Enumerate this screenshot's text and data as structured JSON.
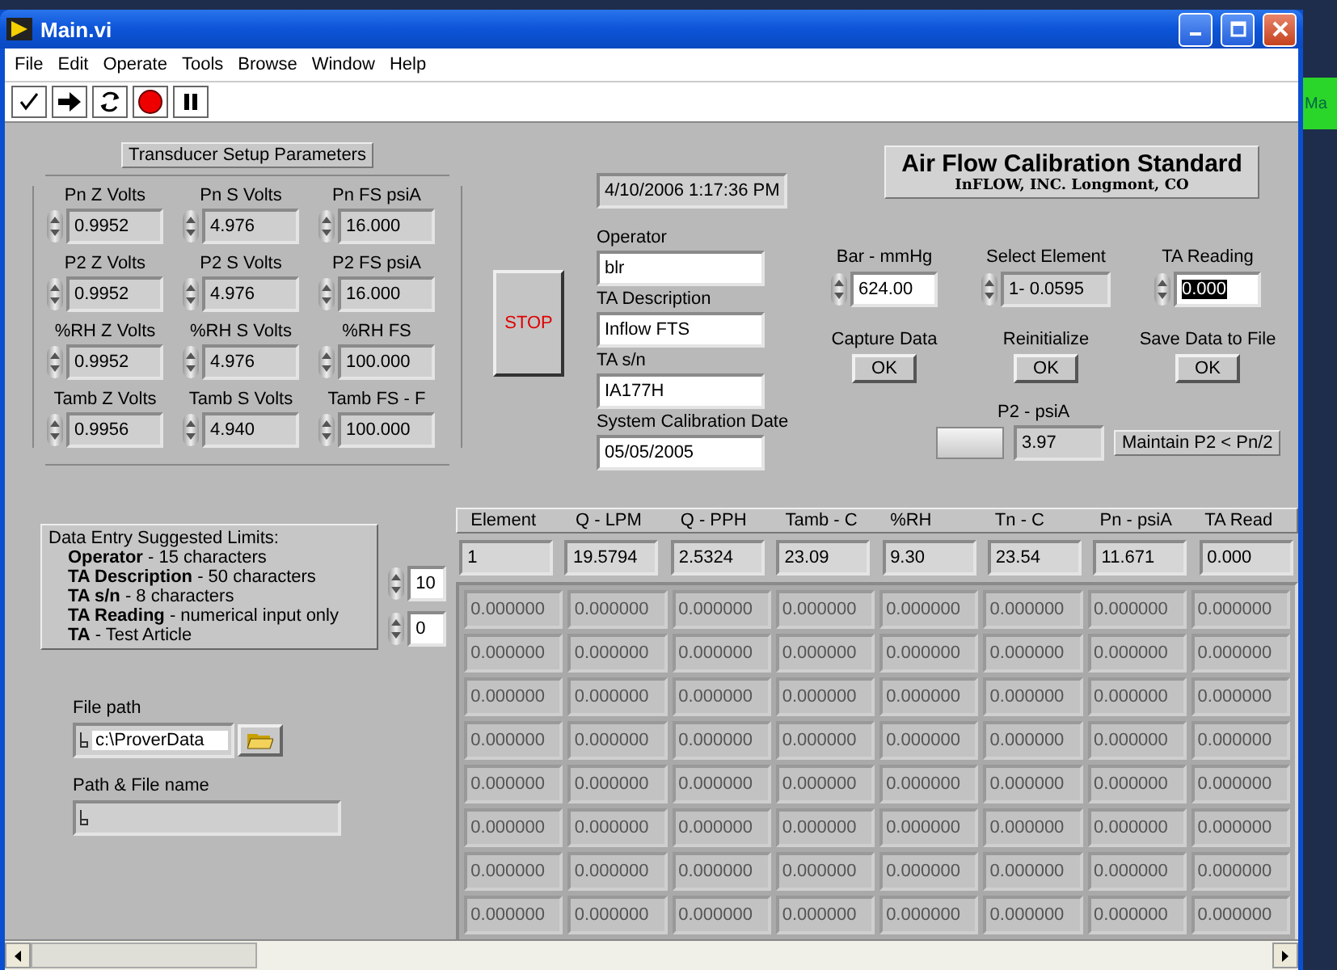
{
  "window": {
    "title": "Main.vi"
  },
  "menu": [
    {
      "label": "File"
    },
    {
      "label": "Edit"
    },
    {
      "label": "Operate"
    },
    {
      "label": "Tools"
    },
    {
      "label": "Browse"
    },
    {
      "label": "Window"
    },
    {
      "label": "Help"
    }
  ],
  "transducer": {
    "title": "Transducer Setup Parameters",
    "fields": [
      {
        "label": "Pn Z Volts",
        "value": "0.9952"
      },
      {
        "label": "Pn S Volts",
        "value": "4.976"
      },
      {
        "label": "Pn FS psiA",
        "value": "16.000"
      },
      {
        "label": "P2 Z Volts",
        "value": "0.9952"
      },
      {
        "label": "P2 S Volts",
        "value": "4.976"
      },
      {
        "label": "P2 FS psiA",
        "value": "16.000"
      },
      {
        "label": "%RH Z Volts",
        "value": "0.9952"
      },
      {
        "label": "%RH S Volts",
        "value": "4.976"
      },
      {
        "label": "%RH FS",
        "value": "100.000"
      },
      {
        "label": "Tamb Z Volts",
        "value": "0.9956"
      },
      {
        "label": "Tamb S Volts",
        "value": "4.940"
      },
      {
        "label": "Tamb FS - F",
        "value": "100.000"
      }
    ]
  },
  "stop_button": {
    "label": "STOP"
  },
  "timestamp": "4/10/2006 1:17:36 PM",
  "text_fields": [
    {
      "label": "Operator",
      "value": "blr"
    },
    {
      "label": "TA Description",
      "value": "Inflow FTS"
    },
    {
      "label": "TA s/n",
      "value": "IA177H"
    },
    {
      "label": "System Calibration Date",
      "value": "05/05/2005"
    }
  ],
  "header": {
    "title": "Air Flow Calibration Standard",
    "subtitle": "InFLOW, INC. Longmont, CO"
  },
  "numeric_controls": [
    {
      "label": "Bar - mmHg",
      "value": "624.00",
      "kind": "control",
      "selected": false
    },
    {
      "label": "Select Element",
      "value": "1- 0.0595",
      "kind": "indicator",
      "selected": false
    },
    {
      "label": "TA Reading",
      "value": "0.000",
      "kind": "control",
      "selected": true
    }
  ],
  "buttons": [
    {
      "caption": "Capture Data",
      "label": "OK"
    },
    {
      "caption": "Reinitialize",
      "label": "OK"
    },
    {
      "caption": "Save Data to File",
      "label": "OK"
    }
  ],
  "p2": {
    "label": "P2 - psiA",
    "value": "3.97",
    "note": "Maintain P2 < Pn/2"
  },
  "limits": {
    "title": "Data Entry Suggested Limits:",
    "lines": [
      "**Operator** - 15 characters",
      "**TA Description** - 50 characters",
      "**TA s/n** - 8 characters",
      "**TA Reading** - numerical input only",
      "**TA** - Test Article"
    ]
  },
  "index_controls": [
    "10",
    "0"
  ],
  "file_path": {
    "label": "File path",
    "value": "c:\\ProverData"
  },
  "path_file_name": {
    "label": "Path & File name"
  },
  "table": {
    "columns": [
      "Element",
      "Q - LPM",
      "Q - PPH",
      "Tamb - C",
      "%RH",
      "Tn - C",
      "Pn - psiA",
      "TA Read"
    ],
    "current": [
      "1",
      "19.5794",
      "2.5324",
      "23.09",
      "9.30",
      "23.54",
      "11.671",
      "0.000"
    ],
    "rows": [
      [
        "0.000000",
        "0.000000",
        "0.000000",
        "0.000000",
        "0.000000",
        "0.000000",
        "0.000000",
        "0.000000"
      ],
      [
        "0.000000",
        "0.000000",
        "0.000000",
        "0.000000",
        "0.000000",
        "0.000000",
        "0.000000",
        "0.000000"
      ],
      [
        "0.000000",
        "0.000000",
        "0.000000",
        "0.000000",
        "0.000000",
        "0.000000",
        "0.000000",
        "0.000000"
      ],
      [
        "0.000000",
        "0.000000",
        "0.000000",
        "0.000000",
        "0.000000",
        "0.000000",
        "0.000000",
        "0.000000"
      ],
      [
        "0.000000",
        "0.000000",
        "0.000000",
        "0.000000",
        "0.000000",
        "0.000000",
        "0.000000",
        "0.000000"
      ],
      [
        "0.000000",
        "0.000000",
        "0.000000",
        "0.000000",
        "0.000000",
        "0.000000",
        "0.000000",
        "0.000000"
      ],
      [
        "0.000000",
        "0.000000",
        "0.000000",
        "0.000000",
        "0.000000",
        "0.000000",
        "0.000000",
        "0.000000"
      ],
      [
        "0.000000",
        "0.000000",
        "0.000000",
        "0.000000",
        "0.000000",
        "0.000000",
        "0.000000",
        "0.000000"
      ]
    ]
  },
  "other_window": {
    "text": "Ma"
  }
}
